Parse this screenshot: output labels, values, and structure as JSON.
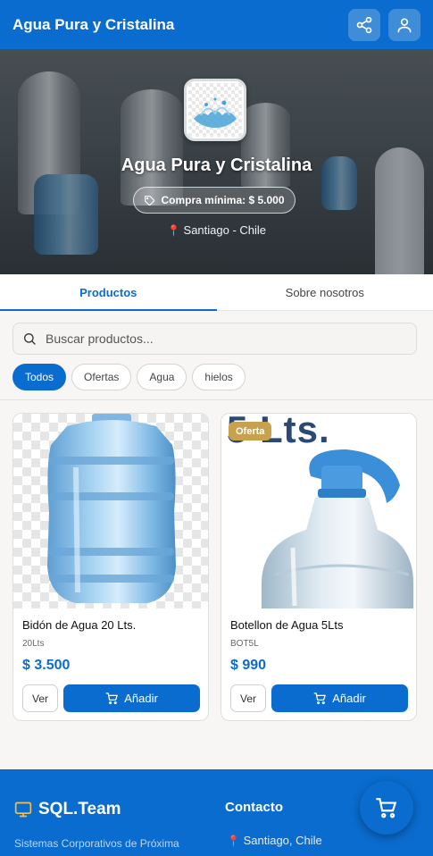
{
  "header": {
    "title": "Agua Pura y Cristalina",
    "share_icon": "share-icon",
    "user_icon": "user-icon"
  },
  "hero": {
    "store_name": "Agua Pura y Cristalina",
    "min_purchase": "Compra mínima: $ 5.000",
    "location": "Santiago - Chile"
  },
  "tabs": [
    {
      "label": "Productos",
      "active": true
    },
    {
      "label": "Sobre nosotros",
      "active": false
    }
  ],
  "search": {
    "placeholder": "Buscar productos..."
  },
  "filters": [
    {
      "label": "Todos",
      "active": true
    },
    {
      "label": "Ofertas",
      "active": false
    },
    {
      "label": "Agua",
      "active": false
    },
    {
      "label": "hielos",
      "active": false
    }
  ],
  "products": [
    {
      "name": "Bidón de Agua 20 Lts.",
      "sku": "20Lts",
      "price": "$ 3.500",
      "view_label": "Ver",
      "add_label": "Añadir",
      "badge": ""
    },
    {
      "name": "Botellon de Agua 5Lts",
      "sku": "BOT5L",
      "price": "$ 990",
      "view_label": "Ver",
      "add_label": "Añadir",
      "badge": "Oferta",
      "image_text": "5 Lts."
    }
  ],
  "footer": {
    "brand": "SQL.Team",
    "tagline": "Sistemas Corporativos de Próxima",
    "contact_title": "Contacto",
    "contact_location": "Santiago, Chile"
  },
  "colors": {
    "primary": "#0a6ccf",
    "badge": "#c7a14d",
    "price": "#0a6ccf"
  }
}
